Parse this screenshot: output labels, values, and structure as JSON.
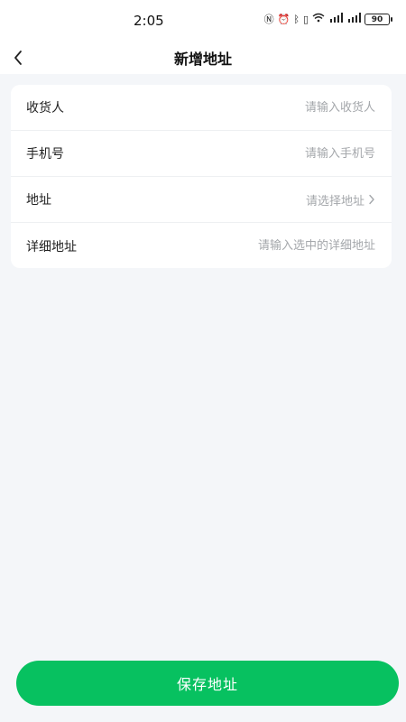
{
  "status_bar": {
    "time": "2:05",
    "icons": [
      "nfc-icon",
      "alarm-icon",
      "bluetooth-icon",
      "vibrate-icon",
      "wifi-icon",
      "signal-4g-icon",
      "signal-4g-icon"
    ],
    "battery": "90"
  },
  "nav": {
    "title": "新增地址",
    "back_icon": "chevron-left-icon"
  },
  "form": {
    "rows": [
      {
        "label": "收货人",
        "placeholder": "请输入收货人",
        "type": "input"
      },
      {
        "label": "手机号",
        "placeholder": "请输入手机号",
        "type": "input"
      },
      {
        "label": "地址",
        "placeholder": "请选择地址",
        "type": "select"
      },
      {
        "label": "详细地址",
        "placeholder": "请输入选中的详细地址",
        "type": "input"
      }
    ]
  },
  "save_button": {
    "label": "保存地址"
  },
  "colors": {
    "accent": "#07c160",
    "background": "#f4f6f9",
    "card": "#ffffff",
    "placeholder": "#a4a7ab"
  }
}
